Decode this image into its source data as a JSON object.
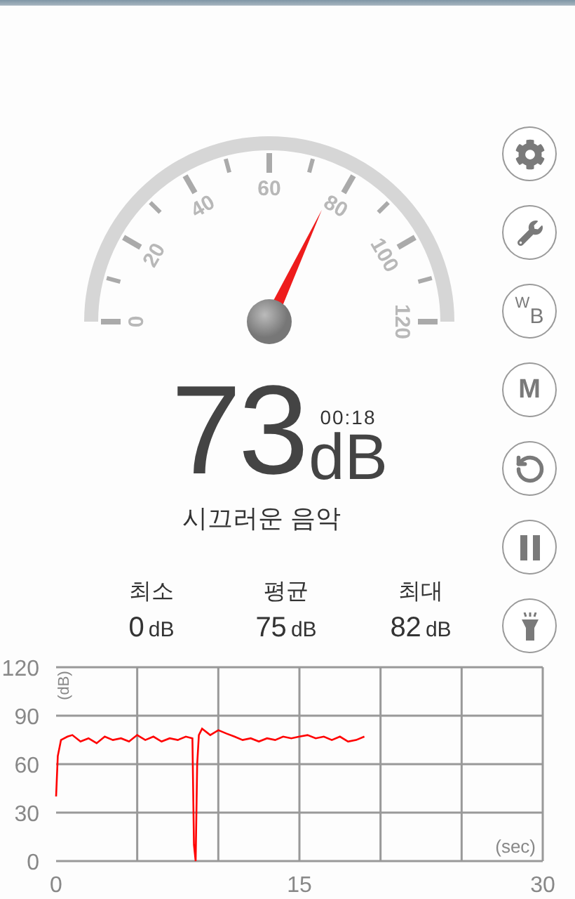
{
  "gauge": {
    "labels": [
      "0",
      "20",
      "40",
      "60",
      "80",
      "100",
      "120"
    ]
  },
  "reading": {
    "value": "73",
    "unit": "dB",
    "time": "00:18",
    "description": "시끄러운 음악"
  },
  "stats": [
    {
      "label": "최소",
      "value": "0",
      "unit": "dB"
    },
    {
      "label": "평균",
      "value": "75",
      "unit": "dB"
    },
    {
      "label": "최대",
      "value": "82",
      "unit": "dB"
    }
  ],
  "buttons": [
    {
      "kind": "gear"
    },
    {
      "kind": "wrench"
    },
    {
      "kind": "text",
      "label": "$^{W}$$_{B}$"
    },
    {
      "kind": "text",
      "label": "M"
    },
    {
      "kind": "reset"
    },
    {
      "kind": "pause"
    },
    {
      "kind": "flashlight"
    }
  ],
  "chart": {
    "chart_data": {
      "type": "line",
      "grid": true,
      "xlabel": "(sec)",
      "ylabel": "(dB)",
      "xlim": [
        0,
        30
      ],
      "ylim": [
        0,
        120
      ],
      "xticks": [
        0,
        15,
        30
      ],
      "yticks": [
        0,
        30,
        60,
        90,
        120
      ],
      "x": [
        0,
        0.1,
        0.3,
        0.7,
        1,
        1.5,
        2,
        2.5,
        3,
        3.5,
        4,
        4.5,
        5,
        5.5,
        6,
        6.5,
        7,
        7.5,
        8,
        8.4,
        8.5,
        8.6,
        8.7,
        8.8,
        9,
        9.5,
        10,
        10.5,
        11,
        11.5,
        12,
        12.5,
        13,
        13.5,
        14,
        14.5,
        15,
        15.5,
        16,
        16.5,
        17,
        17.5,
        18,
        18.5,
        19
      ],
      "series": [
        {
          "color": "#ff0000",
          "values": [
            40,
            65,
            75,
            77,
            78,
            74,
            76,
            73,
            77,
            75,
            76,
            74,
            78,
            75,
            77,
            74,
            76,
            75,
            77,
            76,
            10,
            0,
            60,
            78,
            82,
            78,
            81,
            79,
            77,
            75,
            76,
            74,
            76,
            75,
            77,
            76,
            77,
            78,
            76,
            77,
            75,
            77,
            74,
            75,
            77
          ]
        }
      ]
    }
  }
}
